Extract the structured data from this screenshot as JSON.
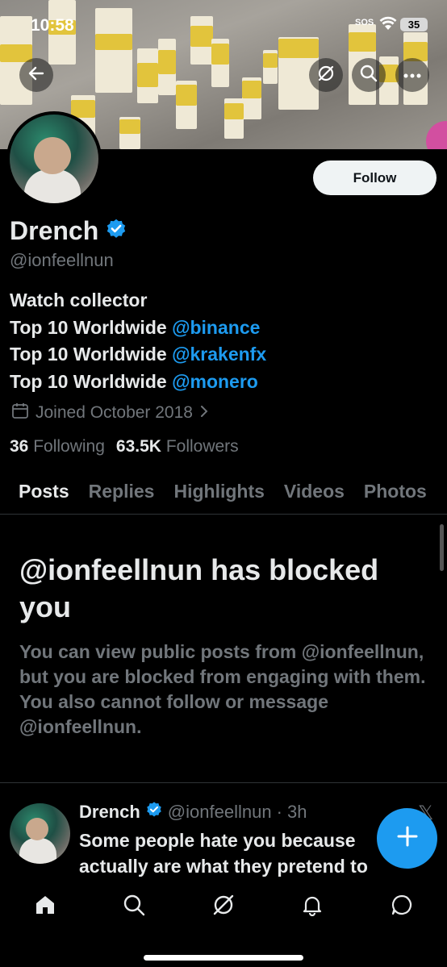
{
  "status_bar": {
    "time": "10:58",
    "sos": "SOS",
    "battery": "35"
  },
  "profile": {
    "display_name": "Drench",
    "handle": "@ionfeellnun",
    "follow_label": "Follow",
    "bio": {
      "line1": "Watch collector",
      "line2_text": "Top 10 Worldwide ",
      "line2_mention": "@binance",
      "line3_text": "Top 10 Worldwide ",
      "line3_mention": "@krakenfx",
      "line4_text": "Top 10 Worldwide ",
      "line4_mention": "@monero"
    },
    "joined": "Joined October 2018",
    "following_count": "36",
    "following_label": "Following",
    "followers_count": "63.5K",
    "followers_label": "Followers"
  },
  "tabs": [
    "Posts",
    "Replies",
    "Highlights",
    "Videos",
    "Photos"
  ],
  "blocked": {
    "title": "@ionfeellnun has blocked you",
    "text": "You can view public posts from @ionfeellnun, but you are blocked from engaging with them. You also cannot follow or message @ionfeellnun."
  },
  "tweet": {
    "name": "Drench",
    "handle": "@ionfeellnun",
    "time": "· 3h",
    "text_line1": "Some people hate you because",
    "text_line2": "actually are what they pretend to"
  },
  "icons": {
    "back": "back-arrow-icon",
    "grok": "grok-icon",
    "search": "search-icon",
    "more": "more-icon",
    "calendar": "calendar-icon",
    "verified": "verified-badge-icon",
    "compose": "plus-icon",
    "nav": [
      "home-icon",
      "search-icon",
      "grok-icon",
      "bell-icon",
      "message-icon"
    ]
  },
  "colors": {
    "accent": "#1d9bf0",
    "background": "#000000",
    "secondary_text": "#71767b"
  }
}
